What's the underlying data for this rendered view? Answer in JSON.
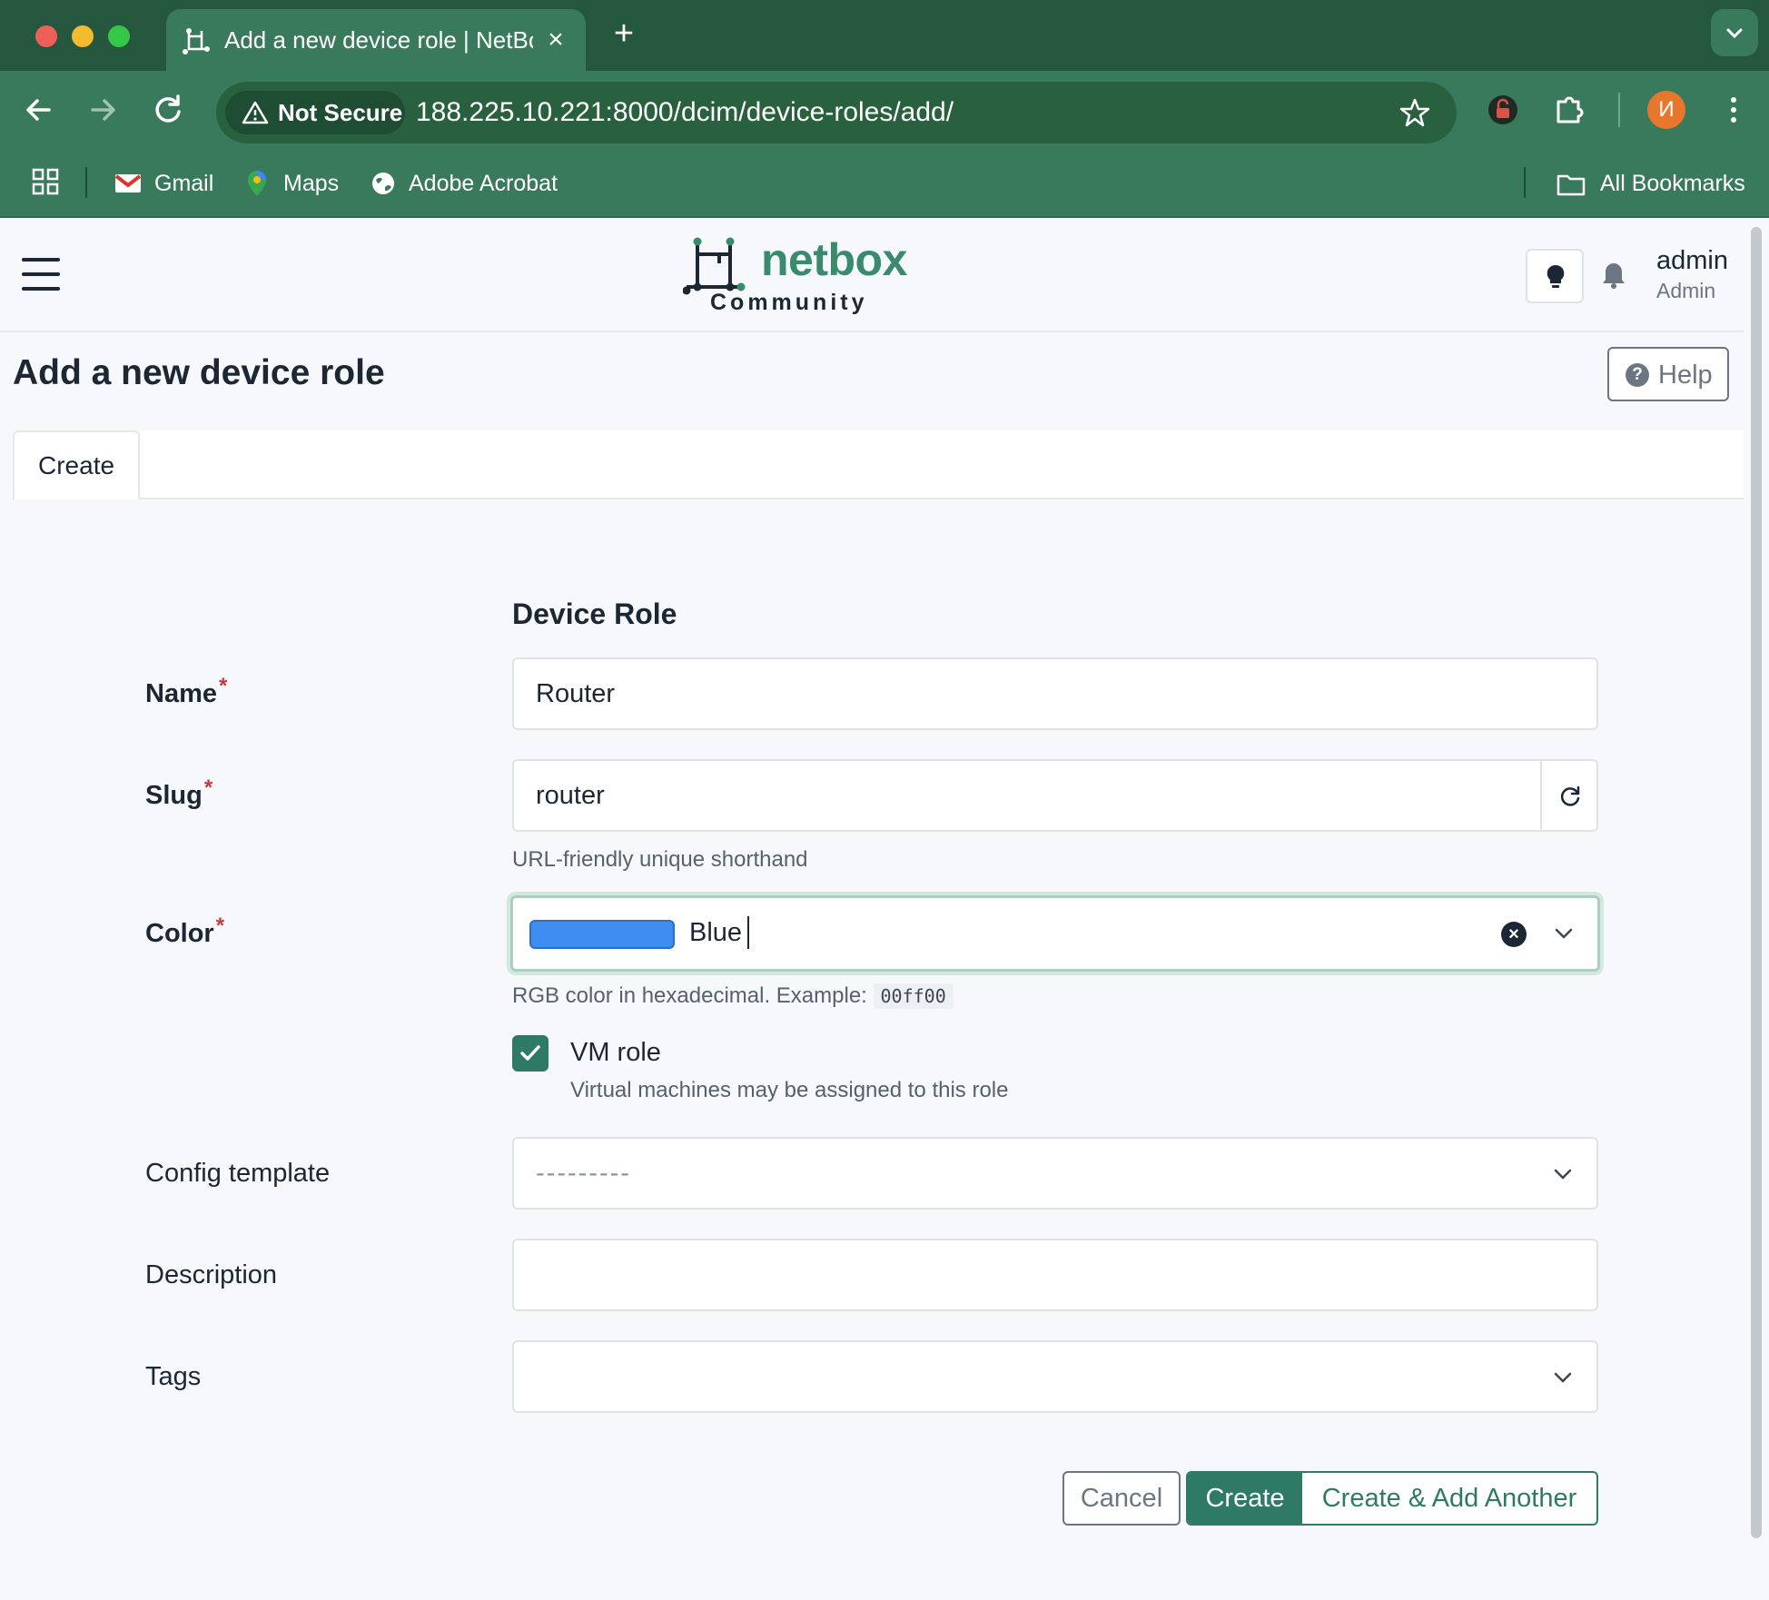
{
  "browser": {
    "tab_title": "Add a new device role | NetBox",
    "tab_close": "×",
    "new_tab": "+",
    "security_label": "Not Secure",
    "url": "188.225.10.221:8000/dcim/device-roles/add/",
    "profile_initial": "И",
    "bookmarks": [
      {
        "label": "Gmail",
        "icon": "gmail-icon"
      },
      {
        "label": "Maps",
        "icon": "maps-icon"
      },
      {
        "label": "Adobe Acrobat",
        "icon": "globe-icon"
      }
    ],
    "all_bookmarks": "All Bookmarks"
  },
  "header": {
    "logo_word": "netbox",
    "logo_sub": "Community",
    "user_name": "admin",
    "user_role": "Admin"
  },
  "page": {
    "title": "Add a new device role",
    "help_label": "Help",
    "help_icon_glyph": "?",
    "tab_create": "Create"
  },
  "form": {
    "section_title": "Device Role",
    "required_mark": "*",
    "name": {
      "label": "Name",
      "value": "Router"
    },
    "slug": {
      "label": "Slug",
      "value": "router",
      "help": "URL-friendly unique shorthand"
    },
    "color": {
      "label": "Color",
      "value": "Blue",
      "swatch": "#3d8ef0",
      "help": "RGB color in hexadecimal. Example:",
      "example": "00ff00",
      "clear_glyph": "×"
    },
    "vm_role": {
      "label": "VM role",
      "checked": true,
      "help": "Virtual machines may be assigned to this role"
    },
    "config_template": {
      "label": "Config template",
      "value": "---------"
    },
    "description": {
      "label": "Description",
      "value": ""
    },
    "tags": {
      "label": "Tags",
      "value": ""
    }
  },
  "actions": {
    "cancel": "Cancel",
    "create": "Create",
    "create_another": "Create & Add Another"
  },
  "colors": {
    "chrome_dark": "#25573f",
    "chrome": "#3a7a5c",
    "primary": "#2f7a65",
    "logo": "#3a8b6e",
    "required": "#c43b3b"
  }
}
